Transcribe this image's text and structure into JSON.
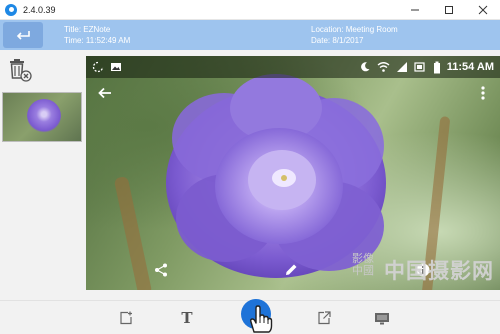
{
  "window": {
    "title": "2.4.0.39",
    "controls": [
      "minimize-icon",
      "maximize-icon",
      "close-icon"
    ]
  },
  "header": {
    "back_icon": "back-arrow-icon",
    "title_line": "Title: EZNote",
    "time_line": "Time: 11:52:49 AM",
    "location_line": "Location: Meeting Room",
    "date_line": "Date: 8/1/2017"
  },
  "sidebar": {
    "delete_icon": "trash-delete-icon",
    "thumbnails": [
      "flower-thumbnail"
    ]
  },
  "viewer": {
    "status_clock": "11:54 AM",
    "status_icons_left": [
      "sync-icon",
      "image-icon"
    ],
    "status_icons_right": [
      "moon-icon",
      "wifi-icon",
      "signal-icon",
      "battery-icon"
    ],
    "overlay_icons": [
      "back-arrow-icon",
      "more-vert-icon",
      "share-icon",
      "edit-icon",
      "info-icon"
    ]
  },
  "watermark": {
    "seal_text": "影像 中國",
    "text": "中国摄影网"
  },
  "toolbar": {
    "items": [
      "add-note-icon",
      "text-icon",
      "touch-icon",
      "export-icon",
      "screen-icon"
    ],
    "text_label": "T"
  },
  "colors": {
    "header_bg": "#9ec4ee",
    "back_button_bg": "#7ea9df",
    "accent_blue": "#1e73d8",
    "flower_purple": "#7a59cf"
  }
}
